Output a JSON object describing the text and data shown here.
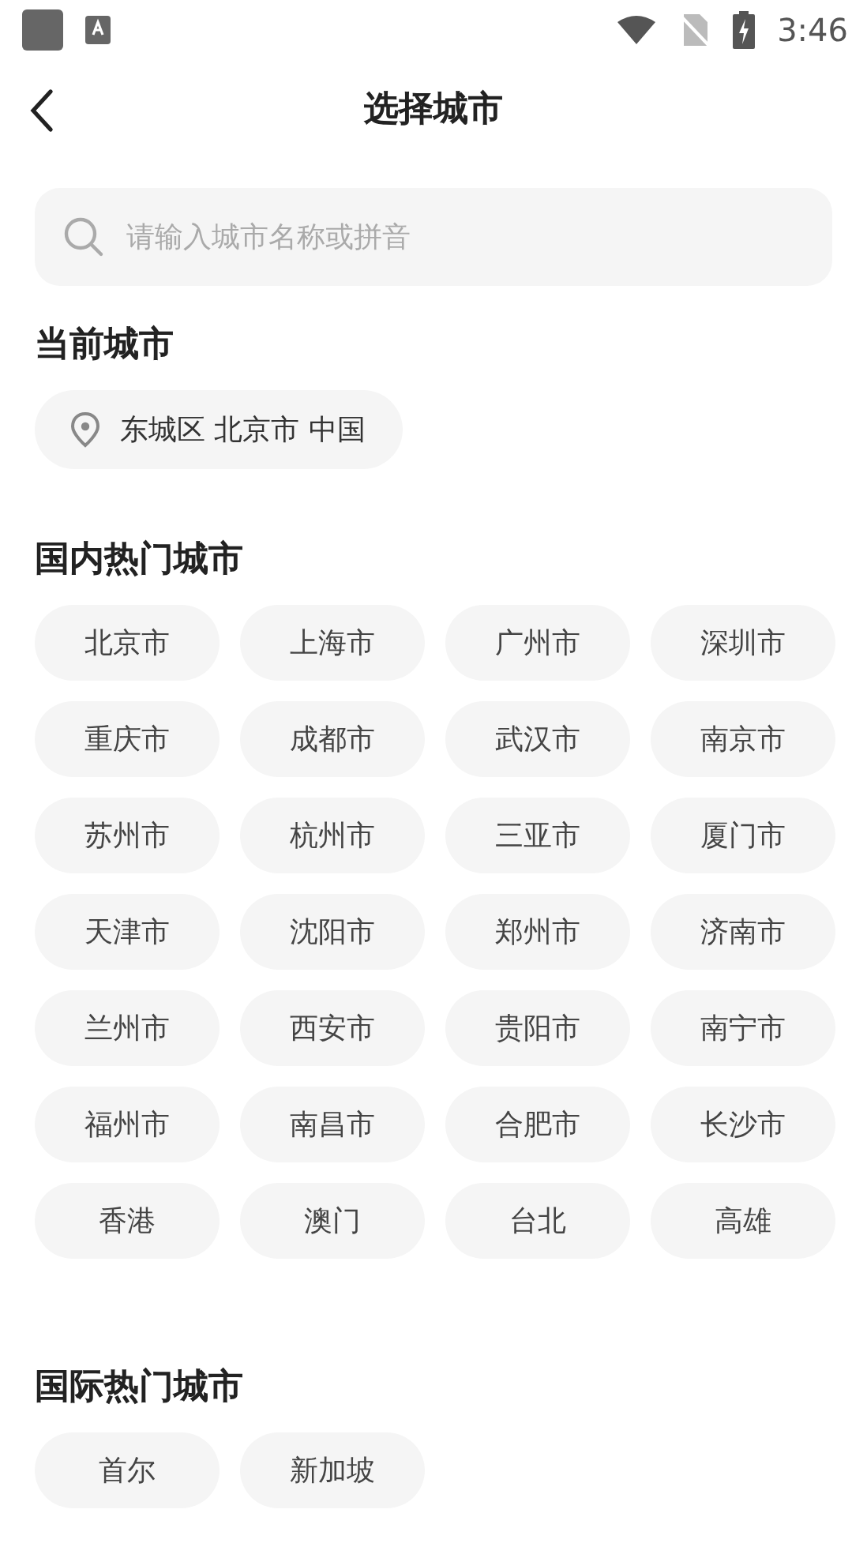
{
  "status_bar": {
    "time": "3:46"
  },
  "header": {
    "title": "选择城市"
  },
  "search": {
    "placeholder": "请输入城市名称或拼音"
  },
  "current_city": {
    "heading": "当前城市",
    "location": "东城区 北京市 中国"
  },
  "domestic": {
    "heading": "国内热门城市",
    "cities": [
      "北京市",
      "上海市",
      "广州市",
      "深圳市",
      "重庆市",
      "成都市",
      "武汉市",
      "南京市",
      "苏州市",
      "杭州市",
      "三亚市",
      "厦门市",
      "天津市",
      "沈阳市",
      "郑州市",
      "济南市",
      "兰州市",
      "西安市",
      "贵阳市",
      "南宁市",
      "福州市",
      "南昌市",
      "合肥市",
      "长沙市",
      "香港",
      "澳门",
      "台北",
      "高雄"
    ]
  },
  "international": {
    "heading": "国际热门城市",
    "cities": [
      "首尔",
      "新加坡"
    ]
  }
}
